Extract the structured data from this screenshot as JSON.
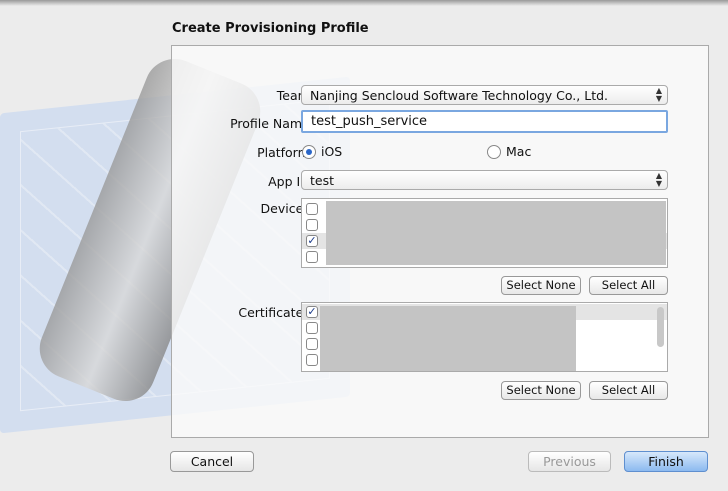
{
  "dialog": {
    "title": "Create Provisioning Profile"
  },
  "form": {
    "team_label": "Team:",
    "team_value": "Nanjing Sencloud Software Technology Co., Ltd.",
    "profile_name_label": "Profile Name:",
    "profile_name_value": "test_push_service",
    "platform_label": "Platform:",
    "platform_options": [
      "iOS",
      "Mac"
    ],
    "platform_selected": "iOS",
    "app_id_label": "App ID:",
    "app_id_value": "test",
    "devices_label": "Devices:",
    "devices_checked": [
      false,
      false,
      true,
      false
    ],
    "certificates_label": "Certificates:",
    "certificates_checked": [
      true,
      false,
      false,
      false
    ],
    "select_none": "Select None",
    "select_all": "Select All"
  },
  "footer": {
    "cancel": "Cancel",
    "previous": "Previous",
    "finish": "Finish"
  },
  "colors": {
    "accent": "#2a66c8",
    "focus": "#7aa7e0"
  }
}
